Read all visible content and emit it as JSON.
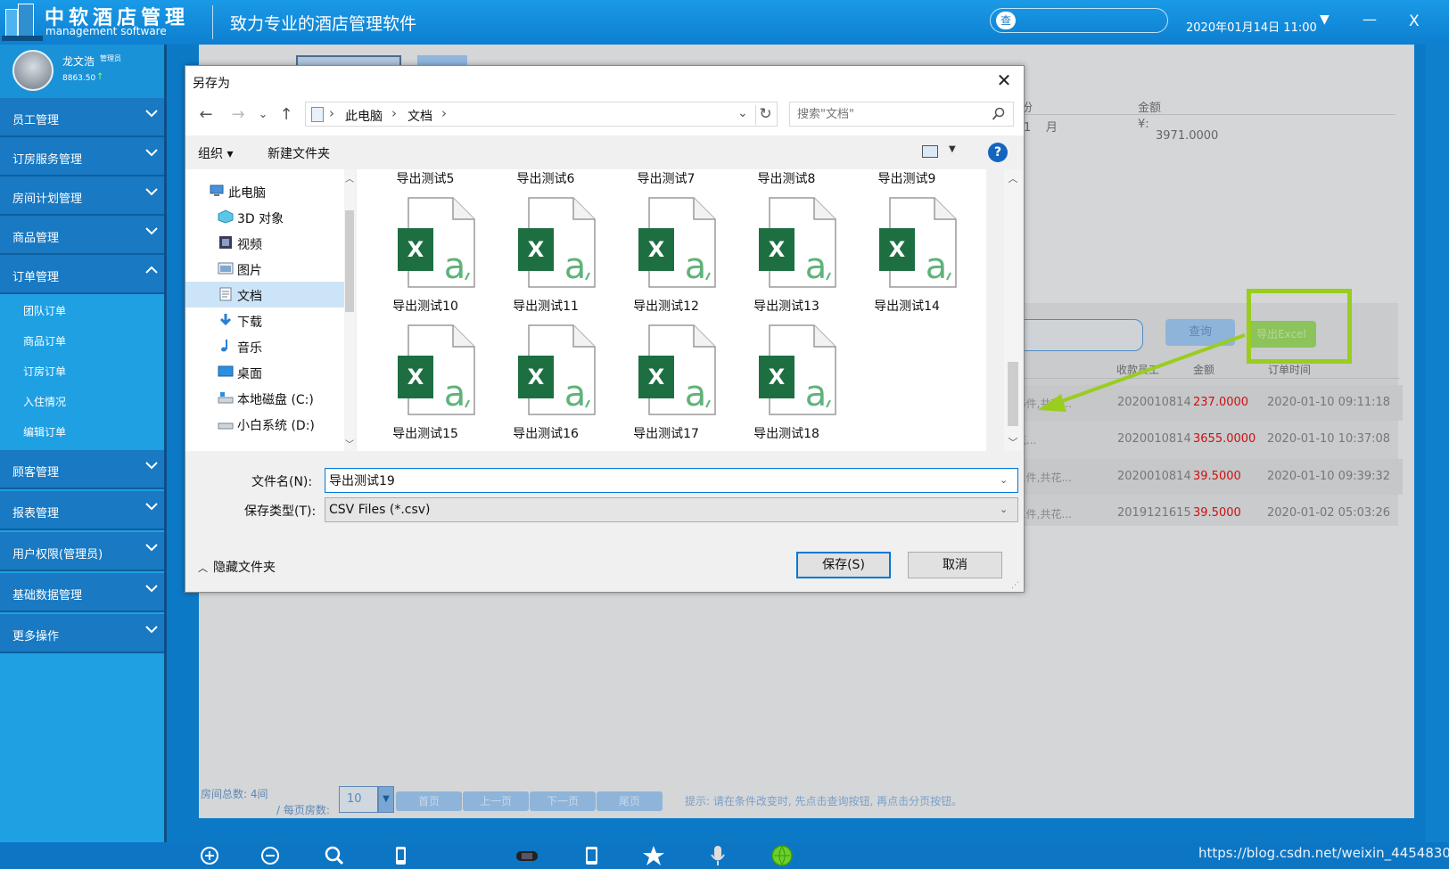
{
  "app": {
    "name": "中软酒店管理",
    "subtitle": "management software",
    "slogan": "致力专业的酒店管理软件",
    "search_button": "查",
    "search_value": "",
    "datetime": "2020年01月14日 11:00",
    "dropdown_icon": "▼",
    "minimize_label": "—",
    "close_label": "X"
  },
  "user": {
    "name": "龙文浩",
    "role": "管理员",
    "balance": "8863.50",
    "balance_arrow": "↑"
  },
  "sidebar": {
    "items": [
      {
        "label": "员工管理"
      },
      {
        "label": "订房服务管理"
      },
      {
        "label": "房间计划管理"
      },
      {
        "label": "商品管理"
      },
      {
        "label": "订单管理"
      },
      {
        "label": "顾客管理"
      },
      {
        "label": "报表管理"
      },
      {
        "label": "用户权限(管理员)"
      },
      {
        "label": "基础数据管理"
      },
      {
        "label": "更多操作"
      }
    ],
    "subitems": [
      {
        "label": "团队订单"
      },
      {
        "label": "商品订单"
      },
      {
        "label": "订房订单"
      },
      {
        "label": "入住情况"
      },
      {
        "label": "编辑订单"
      }
    ]
  },
  "background": {
    "summary": {
      "h1": "月份",
      "h2": "金额",
      "v1": "1",
      "v1b": "月",
      "v2": "¥:",
      "v3": "3971.0000"
    },
    "query_label": "查询",
    "export_label": "导出Excel",
    "columns": {
      "staff": "收款员工",
      "amount": "金额",
      "time": "订单时间"
    },
    "rows": [
      {
        "goods": "采:6件,共花...",
        "id": "2020010814",
        "amount": "237.0000",
        "time": "2020-01-10 09:11:18"
      },
      {
        "goods": "共花...",
        "id": "2020010814",
        "amount": "3655.0000",
        "time": "2020-01-10 10:37:08"
      },
      {
        "goods": "采:1件,共花...",
        "id": "2020010814",
        "amount": "39.5000",
        "time": "2020-01-10 09:39:32"
      },
      {
        "goods": "采:1件,共花...",
        "id": "2019121615",
        "amount": "39.5000",
        "time": "2020-01-02 05:03:26"
      }
    ],
    "pager": {
      "total": "房间总数: 4间",
      "per_page_label": "/ 每页房数:",
      "page_size": "10",
      "first": "首页",
      "prev": "上一页",
      "next": "下一页",
      "last": "尾页",
      "hint": "提示: 请在条件改变时, 先点击查询按钮, 再点击分页按钮。"
    }
  },
  "dialog": {
    "title": "另存为",
    "close": "✕",
    "nav": {
      "back": "←",
      "forward": "→",
      "recent": "⌄",
      "up": "↑"
    },
    "breadcrumb": [
      "此电脑",
      "文档"
    ],
    "search_placeholder": "搜索\"文档\"",
    "organize": "组织",
    "new_folder": "新建文件夹",
    "help": "?",
    "tree": [
      {
        "label": "此电脑",
        "icon": "computer-icon"
      },
      {
        "label": "3D 对象",
        "icon": "3d-objects-icon"
      },
      {
        "label": "视频",
        "icon": "video-icon"
      },
      {
        "label": "图片",
        "icon": "pictures-icon"
      },
      {
        "label": "文档",
        "icon": "documents-icon"
      },
      {
        "label": "下载",
        "icon": "download-icon"
      },
      {
        "label": "音乐",
        "icon": "music-icon"
      },
      {
        "label": "桌面",
        "icon": "desktop-icon"
      },
      {
        "label": "本地磁盘 (C:)",
        "icon": "drive-icon"
      },
      {
        "label": "小白系统 (D:)",
        "icon": "drive-icon"
      }
    ],
    "top_row_files": [
      "导出测试5",
      "导出测试6",
      "导出测试7",
      "导出测试8",
      "导出测试9"
    ],
    "files": [
      "导出测试10",
      "导出测试11",
      "导出测试12",
      "导出测试13",
      "导出测试14",
      "导出测试15",
      "导出测试16",
      "导出测试17",
      "导出测试18"
    ],
    "filename_label": "文件名(N):",
    "filename_value": "导出测试19",
    "filetype_label": "保存类型(T):",
    "filetype_value": "CSV Files (*.csv)",
    "hide_folders": "隐藏文件夹",
    "save": "保存(S)",
    "cancel": "取消"
  },
  "watermark": "https://blog.csdn.net/weixin_44548307",
  "colors": {
    "accent": "#1979c2",
    "highlight": "#9acd1e",
    "amount_red": "#c11111",
    "excel_green": "#1d6f42"
  }
}
